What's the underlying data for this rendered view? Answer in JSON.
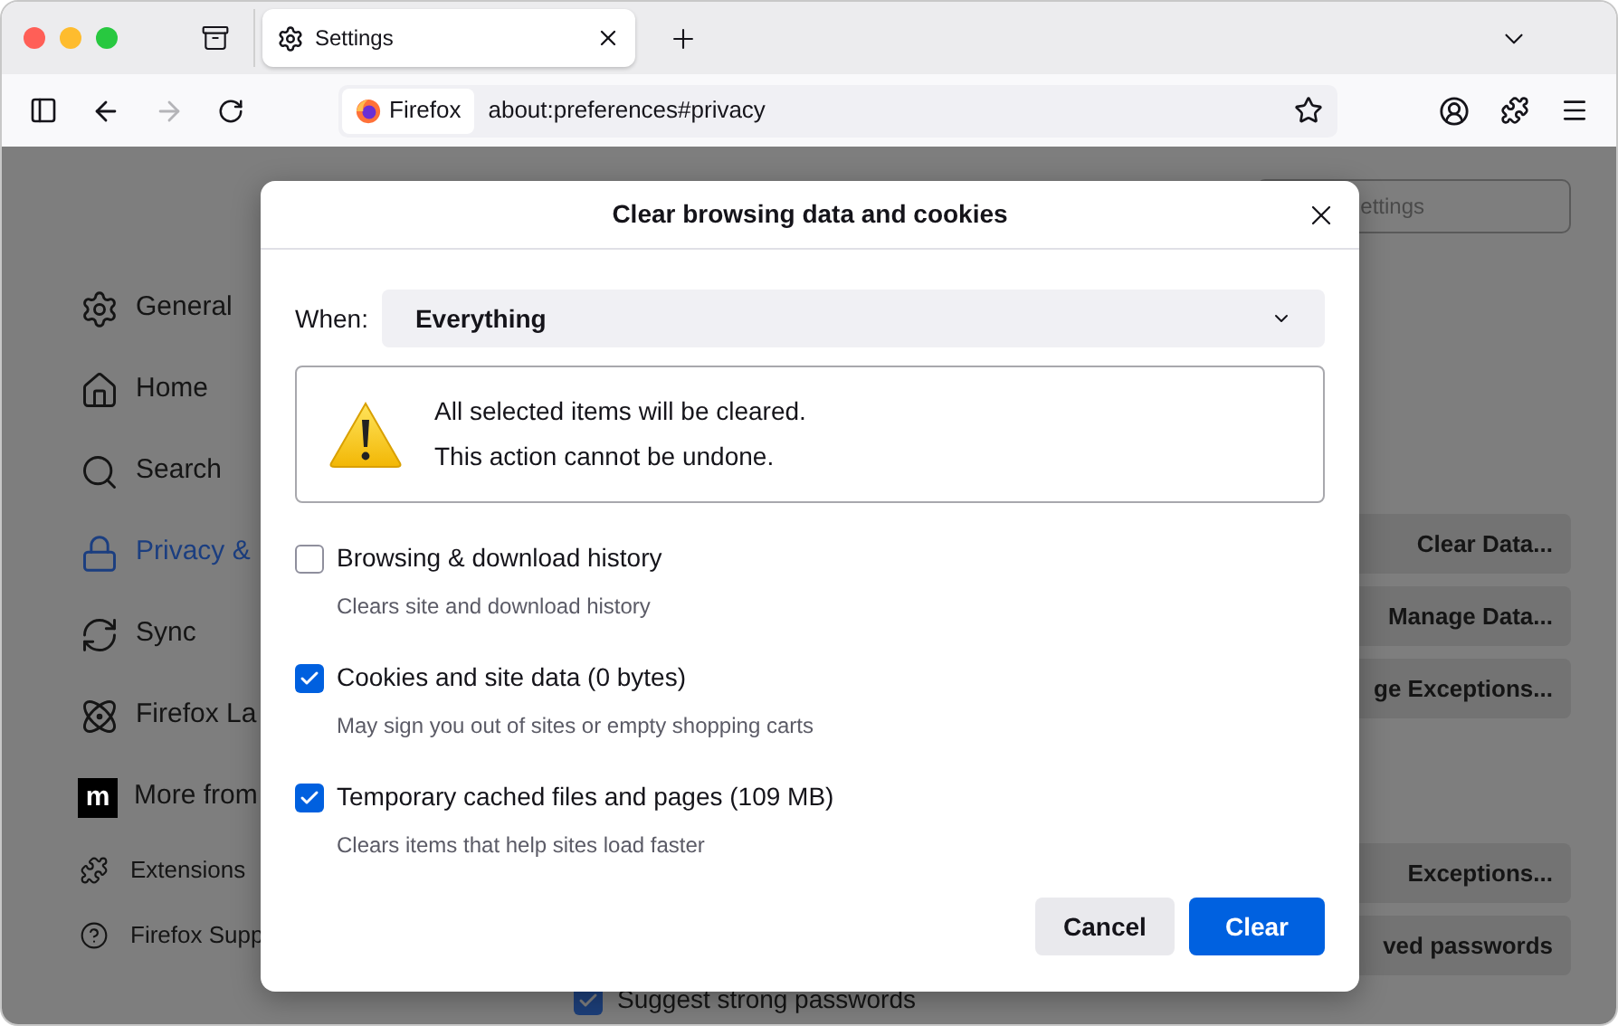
{
  "browser": {
    "tabs": [
      {
        "label": "Settings",
        "selected": true
      }
    ],
    "identity": "Firefox",
    "url": "about:preferences#privacy"
  },
  "sidebar": {
    "items": [
      {
        "label": "General",
        "selected": false,
        "kind": "large"
      },
      {
        "label": "Home",
        "selected": false,
        "kind": "large"
      },
      {
        "label": "Search",
        "selected": false,
        "kind": "large"
      },
      {
        "label": "Privacy &",
        "selected": true,
        "kind": "large"
      },
      {
        "label": "Sync",
        "selected": false,
        "kind": "large"
      },
      {
        "label": "Firefox La",
        "selected": false,
        "kind": "large"
      },
      {
        "label": "More from",
        "selected": false,
        "kind": "logo",
        "logo_letter": "m"
      },
      {
        "label": "Extensions",
        "selected": false,
        "kind": "small"
      },
      {
        "label": "Firefox Supp",
        "selected": false,
        "kind": "small"
      }
    ]
  },
  "settings": {
    "search": {
      "placeholder": "ettings"
    },
    "buttons": [
      {
        "label": "Clear Data..."
      },
      {
        "label": "Manage Data..."
      },
      {
        "label": "ge Exceptions..."
      },
      {
        "label": "Exceptions...",
        "gap": true
      },
      {
        "label": "ved passwords"
      }
    ],
    "checkbox": {
      "label": "Suggest strong passwords",
      "checked": true
    }
  },
  "dialog": {
    "title": "Clear browsing data and cookies",
    "when_label": "When:",
    "when_value": "Everything",
    "warning": [
      "All selected items will be cleared.",
      "This action cannot be undone."
    ],
    "options": [
      {
        "label": "Browsing & download history",
        "description": "Clears site and download history",
        "checked": false
      },
      {
        "label": "Cookies and site data (0 bytes)",
        "description": "May sign you out of sites or empty shopping carts",
        "checked": true
      },
      {
        "label": "Temporary cached files and pages (109 MB)",
        "description": "Clears items that help sites load faster",
        "checked": true
      }
    ],
    "cancel": "Cancel",
    "confirm": "Clear"
  }
}
